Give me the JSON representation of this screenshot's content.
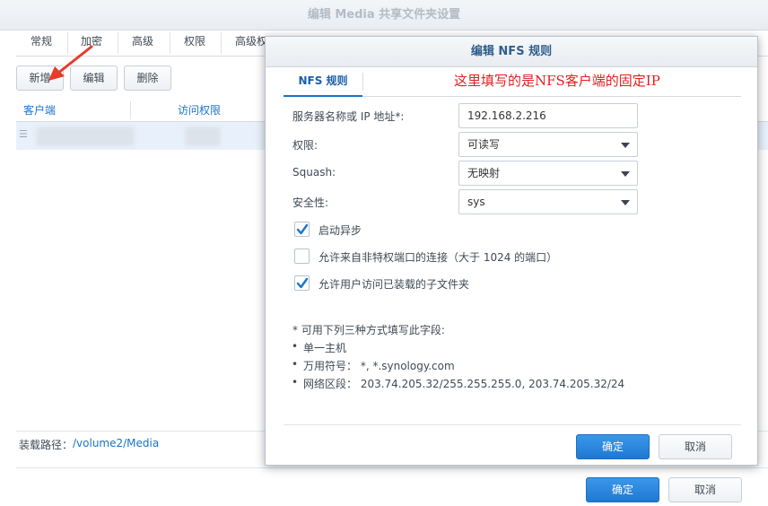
{
  "background_window": {
    "title": "编辑 Media 共享文件夹设置",
    "tabs": [
      "常规",
      "加密",
      "高级",
      "权限",
      "高级权"
    ],
    "toolbar": {
      "add": "新增",
      "edit": "编辑",
      "delete": "删除"
    },
    "grid": {
      "col_client": "客户端",
      "col_access": "访问权限"
    },
    "mount_label": "装载路径：",
    "mount_path": "/volume2/Media",
    "ok": "确定",
    "cancel": "取消"
  },
  "dialog": {
    "title": "编辑 NFS 规则",
    "tab": "NFS 规则",
    "annotation": "这里填写的是NFS客户端的固定IP",
    "fields": {
      "server_label": "服务器名称或 IP 地址*:",
      "server_value": "192.168.2.216",
      "privilege_label": "权限:",
      "privilege_value": "可读写",
      "squash_label": "Squash:",
      "squash_value": "无映射",
      "security_label": "安全性:",
      "security_value": "sys"
    },
    "checkboxes": [
      {
        "label": "启动异步",
        "checked": true
      },
      {
        "label": "允许来自非特权端口的连接（大于 1024 的端口）",
        "checked": false
      },
      {
        "label": "允许用户访问已装载的子文件夹",
        "checked": true
      }
    ],
    "note": "* 可用下列三种方式填写此字段:",
    "bullets": [
      "单一主机",
      "万用符号： *, *.synology.com",
      "网络区段： 203.74.205.32/255.255.255.0, 203.74.205.32/24"
    ],
    "ok": "确定",
    "cancel": "取消"
  },
  "colors": {
    "accent": "#1a73c8",
    "annotation": "#e02020",
    "selected_row": "#e8f1fb"
  }
}
